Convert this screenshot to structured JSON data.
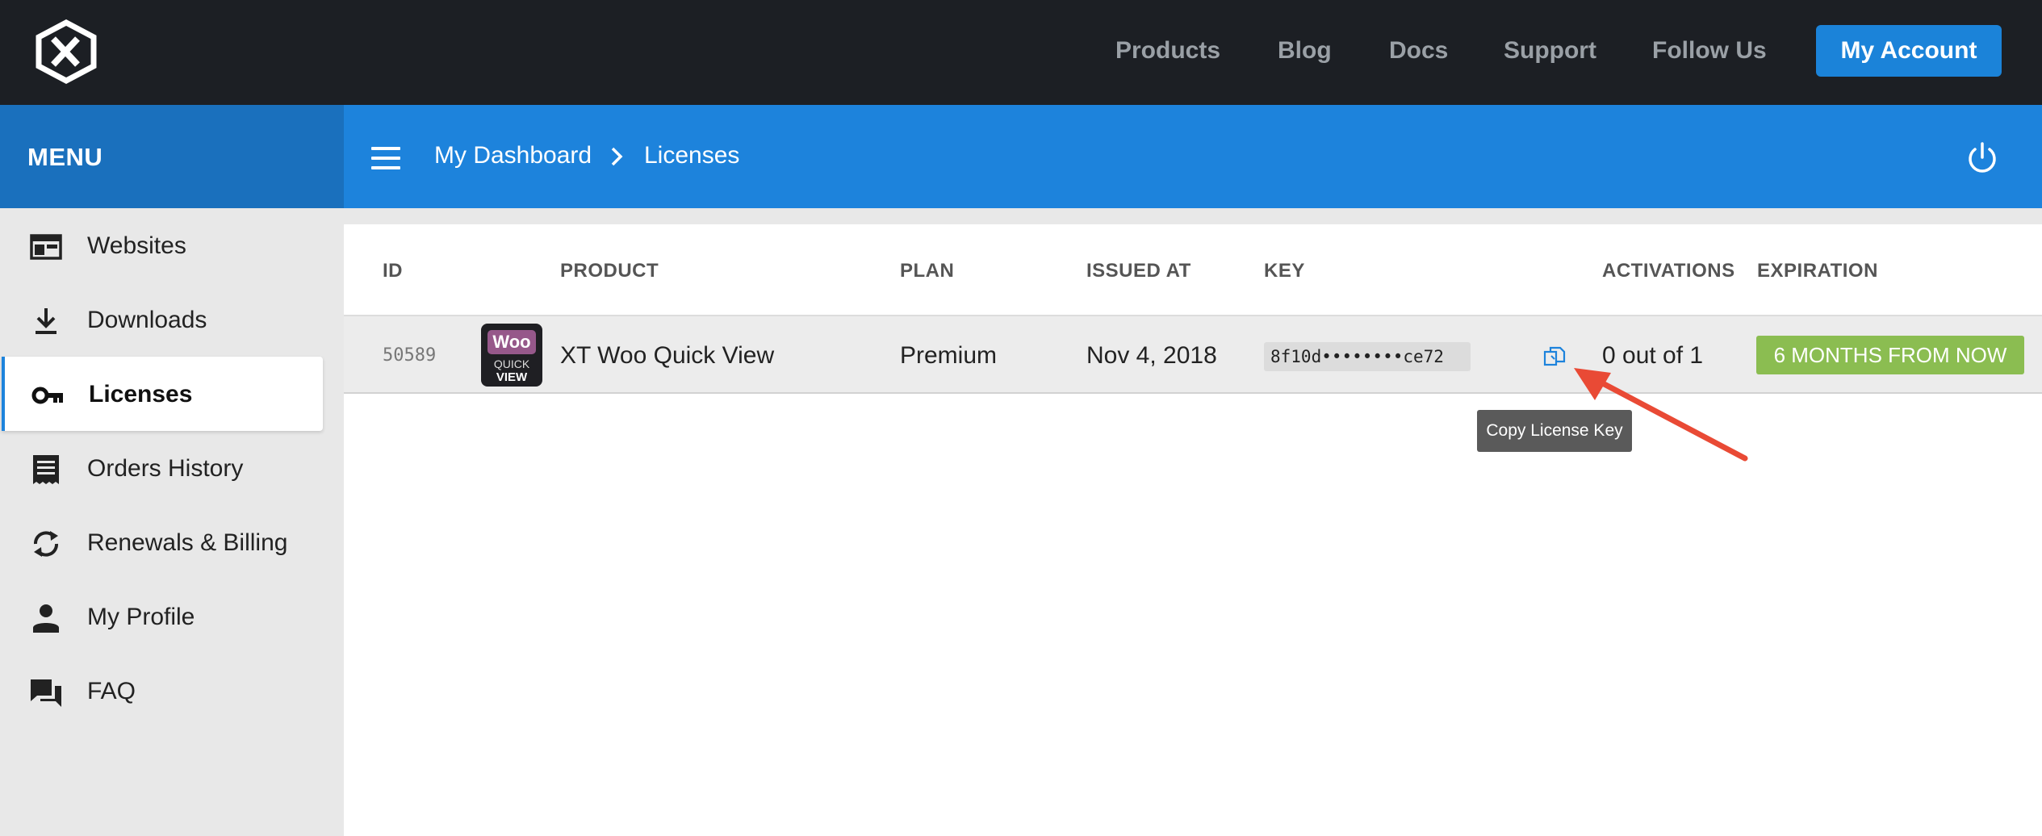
{
  "topnav": {
    "links": [
      "Products",
      "Blog",
      "Docs",
      "Support",
      "Follow Us"
    ],
    "account_button": "My Account"
  },
  "menu": {
    "title": "MENU"
  },
  "breadcrumb": {
    "items": [
      "My Dashboard",
      "Licenses"
    ]
  },
  "sidebar": {
    "items": [
      {
        "label": "Websites",
        "icon": "browser-window-icon"
      },
      {
        "label": "Downloads",
        "icon": "download-icon"
      },
      {
        "label": "Licenses",
        "icon": "key-icon",
        "active": true
      },
      {
        "label": "Orders History",
        "icon": "receipt-icon"
      },
      {
        "label": "Renewals & Billing",
        "icon": "refresh-icon"
      },
      {
        "label": "My Profile",
        "icon": "person-icon"
      },
      {
        "label": "FAQ",
        "icon": "chat-bubbles-icon"
      }
    ]
  },
  "table": {
    "headers": [
      "ID",
      "PRODUCT",
      "PLAN",
      "ISSUED AT",
      "KEY",
      "ACTIVATIONS",
      "EXPIRATION"
    ],
    "rows": [
      {
        "id": "50589",
        "product_logo": {
          "line1": "Woo",
          "line2": "QUICK",
          "line3": "VIEW"
        },
        "product": "XT Woo Quick View",
        "plan": "Premium",
        "issued_at": "Nov 4, 2018",
        "key": "8f10d••••••••ce72",
        "activations": "0 out of 1",
        "expiration": "6 MONTHS FROM NOW"
      }
    ]
  },
  "tooltip": {
    "text": "Copy License Key"
  },
  "colors": {
    "topbar": "#1c1f24",
    "accent_blue": "#1d83dc",
    "menu_blue": "#1a70bd",
    "expiration_green": "#8bbd51",
    "annotation_red": "#e94a35"
  }
}
